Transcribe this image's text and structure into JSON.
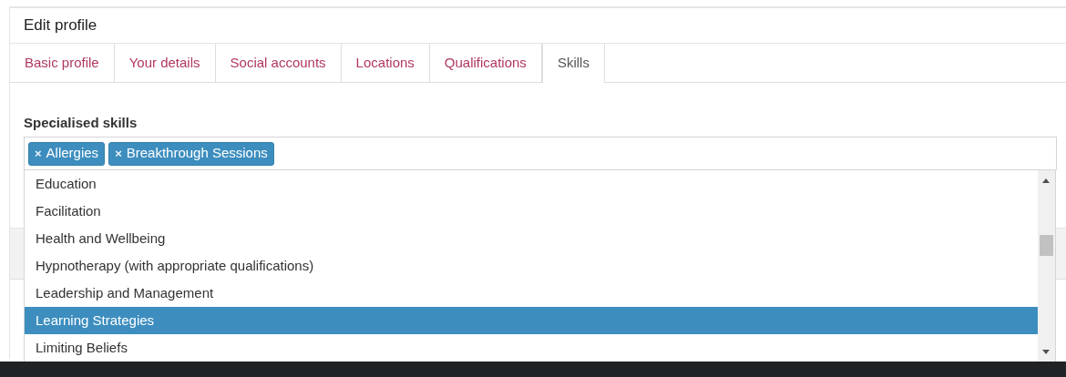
{
  "header": {
    "title": "Edit profile"
  },
  "tabs": [
    {
      "label": "Basic profile",
      "selected": false
    },
    {
      "label": "Your details",
      "selected": false
    },
    {
      "label": "Social accounts",
      "selected": false
    },
    {
      "label": "Locations",
      "selected": false
    },
    {
      "label": "Qualifications",
      "selected": false
    },
    {
      "label": "Skills",
      "selected": true
    }
  ],
  "field": {
    "label": "Specialised skills",
    "tags": [
      {
        "remove": "×",
        "label": "Allergies"
      },
      {
        "remove": "×",
        "label": "Breakthrough Sessions"
      }
    ]
  },
  "dropdown": {
    "options": [
      {
        "label": "Education",
        "selected": false
      },
      {
        "label": "Facilitation",
        "selected": false
      },
      {
        "label": "Health and Wellbeing",
        "selected": false
      },
      {
        "label": "Hypnotherapy (with appropriate qualifications)",
        "selected": false
      },
      {
        "label": "Leadership and Management",
        "selected": false
      },
      {
        "label": "Learning Strategies",
        "selected": true
      },
      {
        "label": "Limiting Beliefs",
        "selected": false
      }
    ]
  }
}
